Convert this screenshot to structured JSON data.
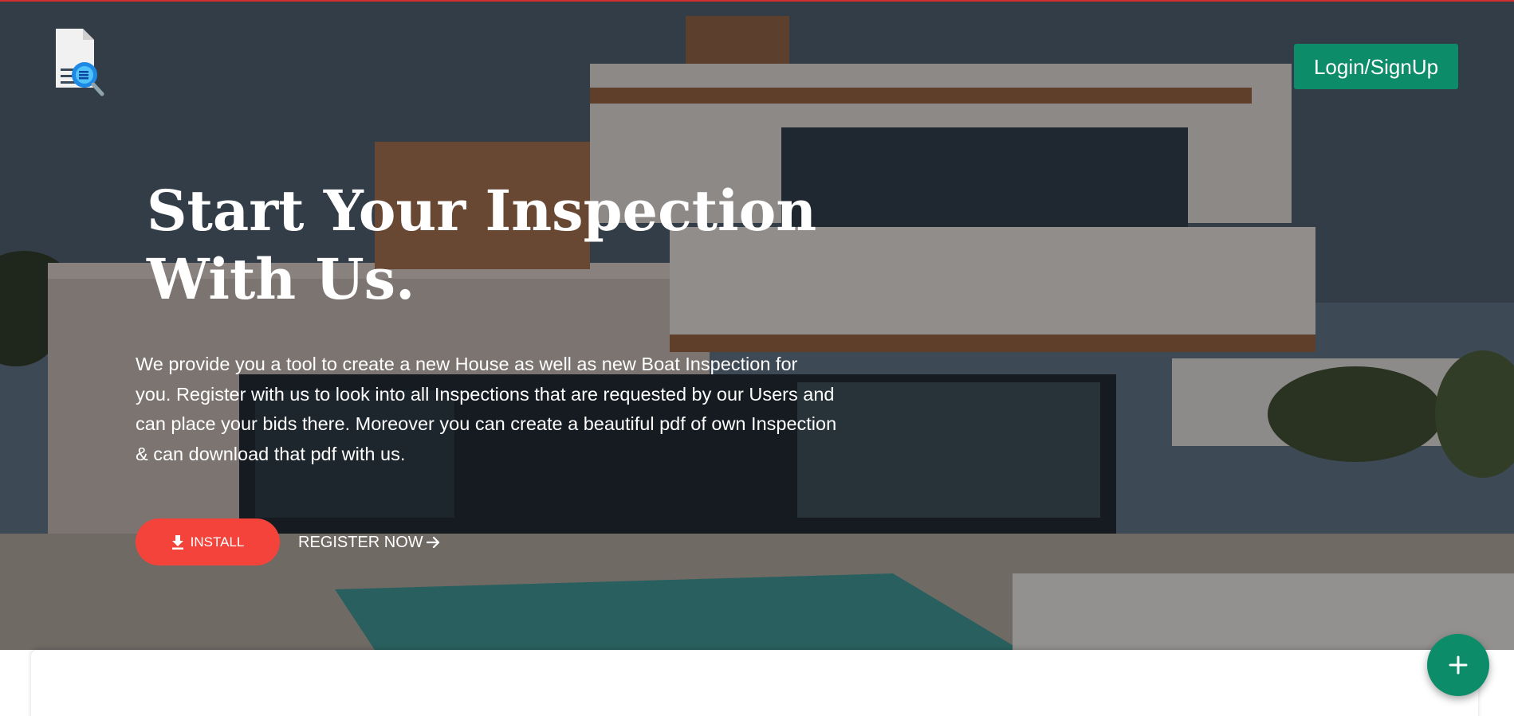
{
  "header": {
    "logo_icon": "document-search-icon",
    "login_label": "Login/SignUp"
  },
  "hero": {
    "background_image": "modern-house-with-pool",
    "title_line1": "Start Your Inspection",
    "title_line2": "With Us.",
    "description": "We provide you a tool to create a new House as well as new Boat Inspection for you. Register with us to look into all Inspections that are requested by our Users and can place your bids there. Moreover you can create a beautiful pdf of own Inspection & can download that pdf with us.",
    "install_label": "INSTALL",
    "install_icon": "download-icon",
    "register_label": "REGISTER NOW",
    "register_icon": "arrow-right-icon"
  },
  "fab": {
    "icon": "plus-icon"
  },
  "colors": {
    "brand_green": "#0d8c6a",
    "install_red": "#f4433a",
    "top_accent": "#d32f2f"
  }
}
